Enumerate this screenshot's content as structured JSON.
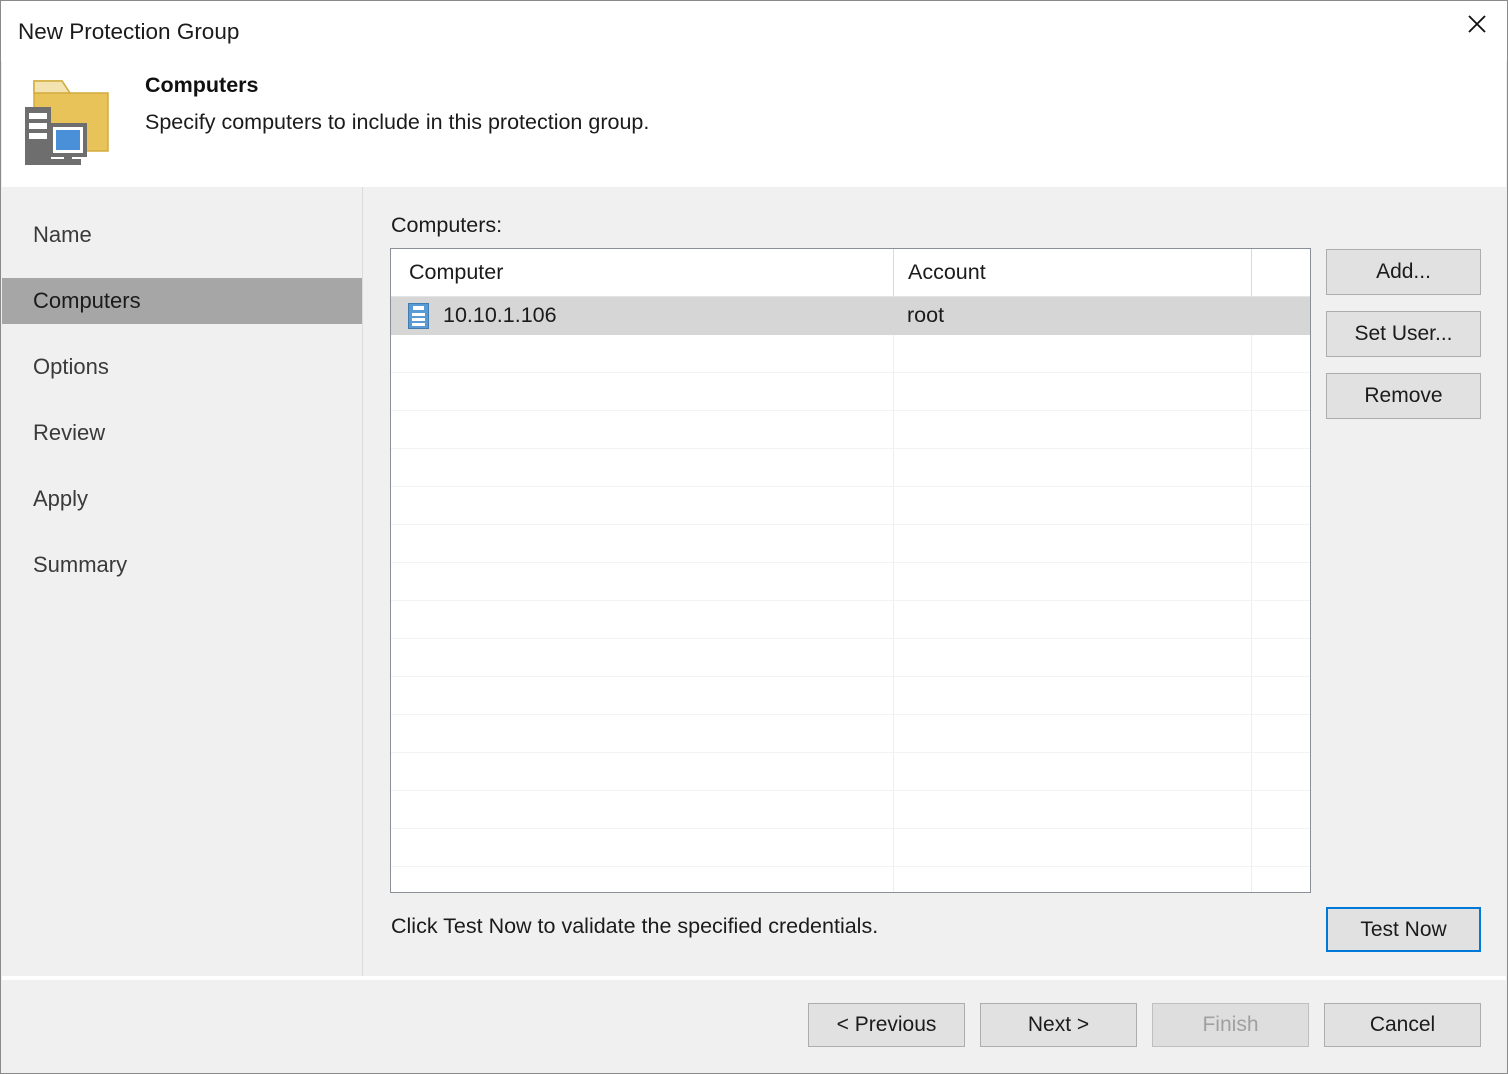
{
  "window": {
    "title": "New Protection Group",
    "close_icon": "close-icon"
  },
  "header": {
    "icon": "protection-group-computers-icon",
    "title": "Computers",
    "subtitle": "Specify computers to include in this protection group."
  },
  "sidebar": {
    "items": [
      {
        "label": "Name",
        "selected": false
      },
      {
        "label": "Computers",
        "selected": true
      },
      {
        "label": "Options",
        "selected": false
      },
      {
        "label": "Review",
        "selected": false
      },
      {
        "label": "Apply",
        "selected": false
      },
      {
        "label": "Summary",
        "selected": false
      }
    ]
  },
  "main": {
    "list_label": "Computers:",
    "table": {
      "columns": [
        "Computer",
        "Account",
        ""
      ],
      "rows": [
        {
          "computer": "10.10.1.106",
          "account": "root",
          "icon": "server-icon",
          "selected": true
        }
      ],
      "empty_row_count": 16
    },
    "side_buttons": [
      {
        "label": "Add...",
        "enabled": true
      },
      {
        "label": "Set User...",
        "enabled": true
      },
      {
        "label": "Remove",
        "enabled": true
      }
    ],
    "hint": "Click Test Now to validate the specified credentials.",
    "test_button": {
      "label": "Test Now",
      "focused": true
    }
  },
  "footer": {
    "buttons": [
      {
        "label": "< Previous",
        "enabled": true
      },
      {
        "label": "Next >",
        "enabled": true
      },
      {
        "label": "Finish",
        "enabled": false
      },
      {
        "label": "Cancel",
        "enabled": true
      }
    ]
  },
  "colors": {
    "accent": "#0078d7",
    "selected_nav": "#a6a6a6",
    "selected_row": "#d6d6d6",
    "folder_yellow": "#e8c35a",
    "server_gray": "#6e6e6e",
    "screen_blue": "#4a90d9"
  }
}
